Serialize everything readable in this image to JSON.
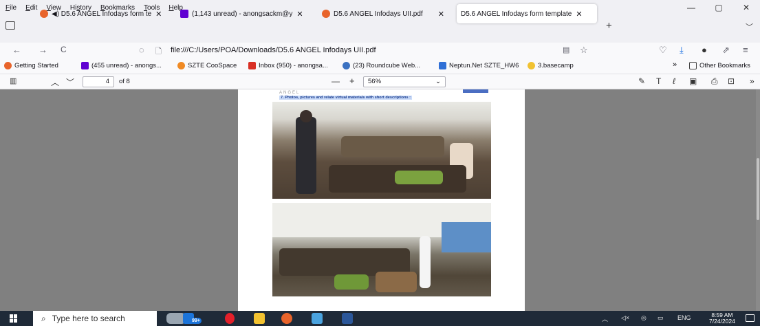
{
  "menu": [
    {
      "pre": "",
      "u": "F",
      "post": "ile"
    },
    {
      "pre": "",
      "u": "E",
      "post": "dit"
    },
    {
      "pre": "",
      "u": "V",
      "post": "iew"
    },
    {
      "pre": "Hi",
      "u": "s",
      "post": "tory"
    },
    {
      "pre": "",
      "u": "B",
      "post": "ookmarks"
    },
    {
      "pre": "",
      "u": "T",
      "post": "ools"
    },
    {
      "pre": "",
      "u": "H",
      "post": "elp"
    }
  ],
  "window_controls": {
    "minimize": "—",
    "restore": "▢",
    "close": "✕"
  },
  "tabs": [
    {
      "label": "◀) D5.6 ANGEL Infodays form te",
      "color": "#e8642b"
    },
    {
      "label": "(1,143 unread) - anongsackm@y",
      "color": "#6001d2"
    },
    {
      "label": "D5.6 ANGEL Infodays UII.pdf",
      "color": "#e8642b"
    },
    {
      "label": "D5.6 ANGEL Infodays form template",
      "color": ""
    }
  ],
  "tab_close": "✕",
  "new_tab": "+",
  "tab_menu": "﹀",
  "nav": {
    "back": "←",
    "forward": "→",
    "reload": "C",
    "shield": "◌",
    "page": "🗋",
    "url": "file:///C:/Users/POA/Downloads/D5.6 ANGEL Infodays UII.pdf",
    "reader": "▤",
    "star": "☆",
    "pocket": "♡",
    "download": "⤓",
    "account": "●",
    "extensions": "⇗",
    "menu": "≡"
  },
  "bookmarks": [
    {
      "label": "Getting Started",
      "color": "#e8642b"
    },
    {
      "label": "(455 unread) - anongs...",
      "color": "#6001d2"
    },
    {
      "label": "SZTE CooSpace",
      "color": "#f08a24"
    },
    {
      "label": "Inbox (950) - anongsa...",
      "color": "#d93025"
    },
    {
      "label": "(23) Roundcube Web...",
      "color": "#3b72c2"
    },
    {
      "label": "Neptun.Net SZTE_HW6",
      "color": "#2f6fd6"
    },
    {
      "label": "3.basecamp",
      "color": "#f1c232"
    }
  ],
  "bookmarks_overflow": "»",
  "other_bookmarks": "Other Bookmarks",
  "pdf_toolbar": {
    "sidebar": "▥",
    "prev": "︿",
    "next": "﹀",
    "page_number": "4",
    "page_count": "of 8",
    "zoom_out": "—",
    "zoom_in": "+",
    "zoom_value": "56%",
    "zoom_chevron": "⌄",
    "highlight": "✎",
    "text": "T",
    "draw": "ℓ",
    "image": "▣",
    "print": "⎙",
    "save": "⊡",
    "overflow": "»"
  },
  "pdf_page": {
    "logo": "ANGEL",
    "caption": "7.   Photos, pictures and relate virtual materials with short descriptions :"
  },
  "taskbar": {
    "search_placeholder": "Type here to search",
    "search_icon": "⌕",
    "badge": "99+",
    "tray_chevron": "︿",
    "tray_volume": "◁×",
    "tray_network": "◎",
    "tray_battery": "▭",
    "language": "ENG",
    "time": "8:59 AM",
    "date": "7/24/2024"
  }
}
